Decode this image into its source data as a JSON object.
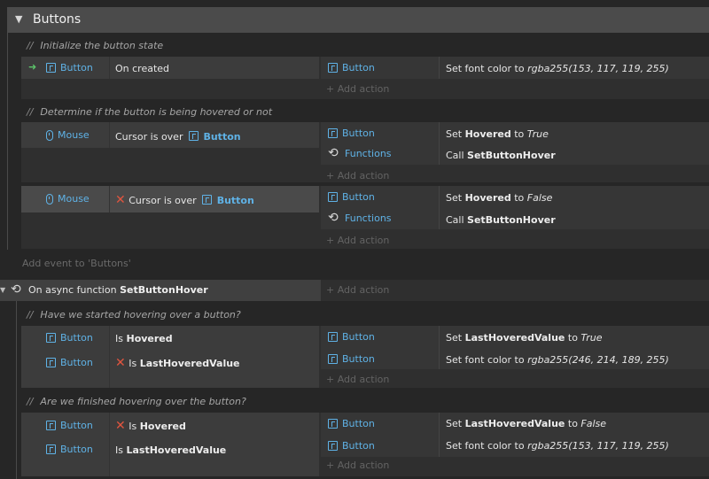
{
  "group": {
    "title": "Buttons",
    "collapse_glyph": "▼"
  },
  "add_event_label": "Add event to 'Buttons'",
  "add_action_label": "Add action",
  "comments": {
    "c1": "Initialize the button state",
    "c2": "Determine if the button is being hovered or not",
    "c3": "Have we started hovering over a button?",
    "c4": "Are we finished hovering over the button?"
  },
  "events": {
    "e1": {
      "cond_object": "Button",
      "cond_text": "On created",
      "action_object": "Button",
      "action_text": "Set font color to",
      "action_value": "rgba255(153, 117, 119, 255)"
    },
    "e2": {
      "cond_object": "Mouse",
      "cond_text": "Cursor is over",
      "cond_target": "Button",
      "a1_object": "Button",
      "a1_set": "Set",
      "a1_var": "Hovered",
      "a1_to": "to",
      "a1_val": "True",
      "a2_object": "Functions",
      "a2_call": "Call",
      "a2_fn": "SetButtonHover"
    },
    "e3": {
      "cond_object": "Mouse",
      "cond_text": "Cursor is over",
      "cond_target": "Button",
      "a1_object": "Button",
      "a1_set": "Set",
      "a1_var": "Hovered",
      "a1_to": "to",
      "a1_val": "False",
      "a2_object": "Functions",
      "a2_call": "Call",
      "a2_fn": "SetButtonHover"
    },
    "fn": {
      "prefix": "On async function",
      "name": "SetButtonHover"
    },
    "e4": {
      "c1_object": "Button",
      "c1_is": "Is",
      "c1_var": "Hovered",
      "c2_object": "Button",
      "c2_is": "Is",
      "c2_var": "LastHoveredValue",
      "a1_object": "Button",
      "a1_set": "Set",
      "a1_var": "LastHoveredValue",
      "a1_to": "to",
      "a1_val": "True",
      "a2_object": "Button",
      "a2_text": "Set font color to",
      "a2_val": "rgba255(246, 214, 189, 255)"
    },
    "e5": {
      "c1_object": "Button",
      "c1_is": "Is",
      "c1_var": "Hovered",
      "c2_object": "Button",
      "c2_is": "Is",
      "c2_var": "LastHoveredValue",
      "a1_object": "Button",
      "a1_set": "Set",
      "a1_var": "LastHoveredValue",
      "a1_to": "to",
      "a1_val": "False",
      "a2_object": "Button",
      "a2_text": "Set font color to",
      "a2_val": "rgba255(153, 117, 119, 255)"
    }
  },
  "icons": {
    "object": "sprite-font-icon",
    "mouse": "mouse-icon",
    "functions": "functions-loop-icon",
    "trigger": "trigger-arrow-icon",
    "invert": "invert-x-icon",
    "comment": "comment-slash-icon"
  },
  "colors": {
    "object_blue": "#5fb2e6",
    "invert_red": "#e0553f",
    "trigger_green": "#5cc36a",
    "group_header": "#4b4b4b"
  }
}
